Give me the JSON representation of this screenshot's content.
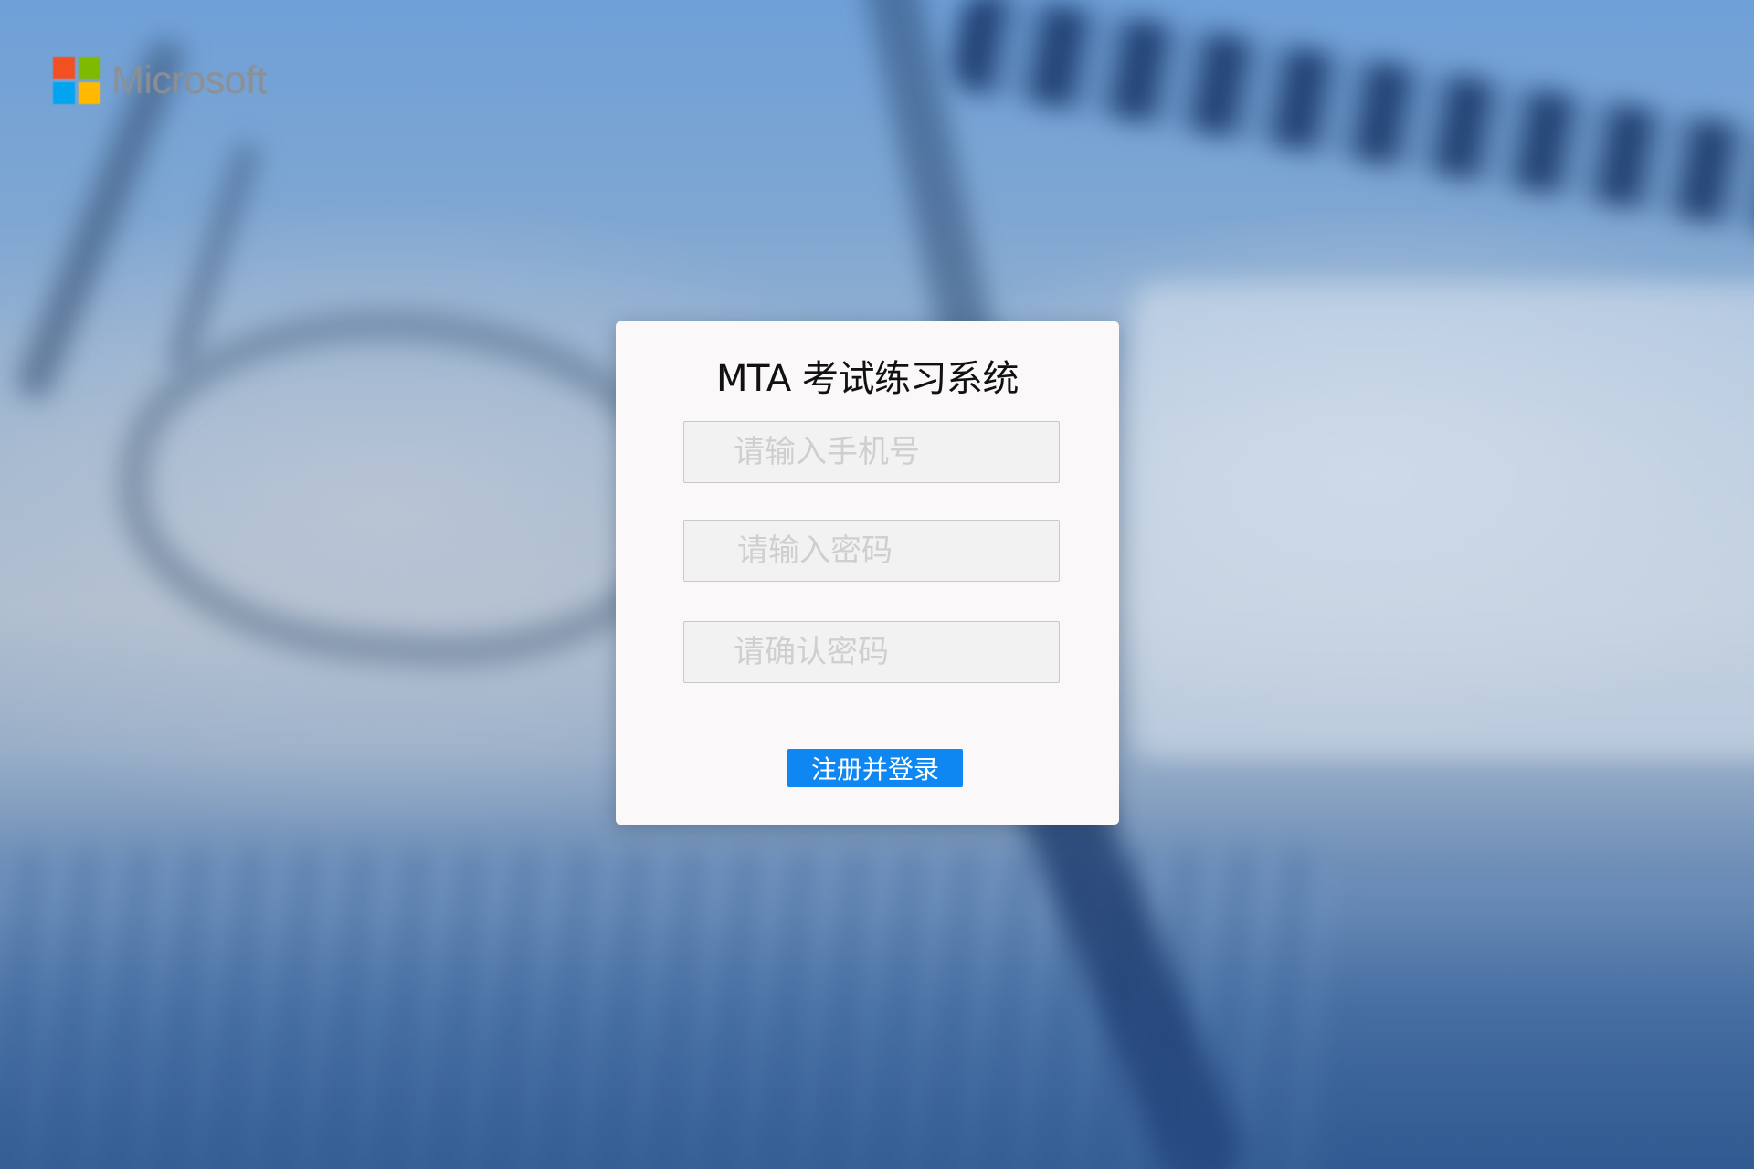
{
  "brand": {
    "logo_text": "Microsoft",
    "logo_colors": [
      "#f25022",
      "#7fba00",
      "#00a4ef",
      "#ffb900"
    ]
  },
  "login_card": {
    "title": "MTA 考试练习系统",
    "phone_input": {
      "value": "",
      "placeholder": "请输入手机号"
    },
    "password_input": {
      "value": "",
      "placeholder": "请输入密码"
    },
    "confirm_password_input": {
      "value": "",
      "placeholder": "请确认密码"
    },
    "submit_label": "注册并登录"
  },
  "colors": {
    "accent": "#0f87f2",
    "card_background": "#faf8f8",
    "input_background": "#f3f2f2"
  }
}
